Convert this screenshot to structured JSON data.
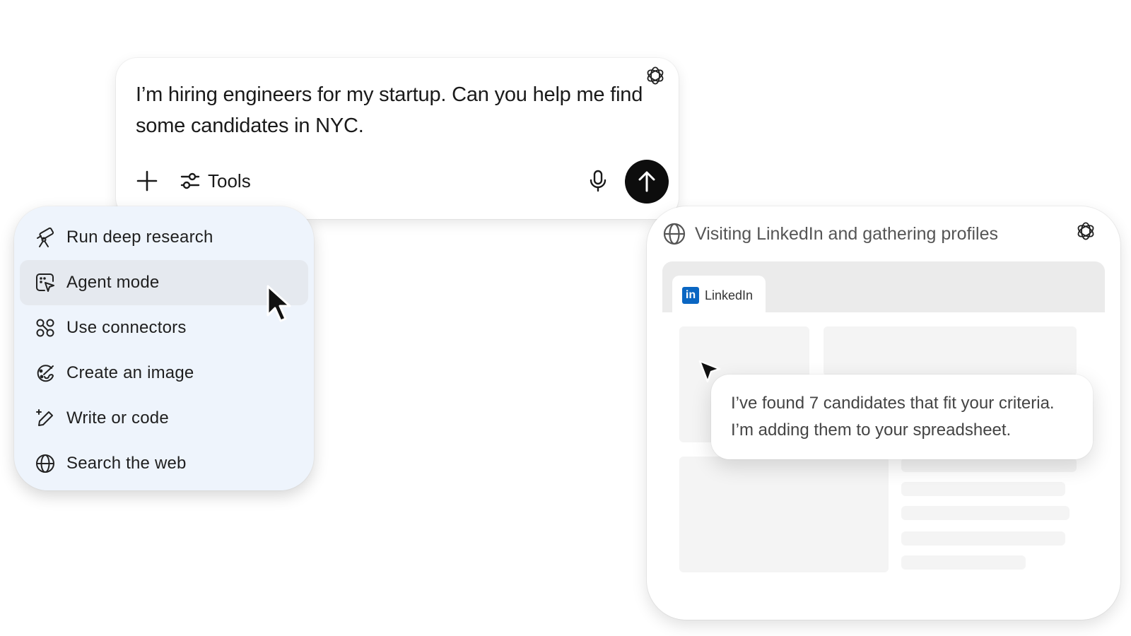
{
  "composer": {
    "prompt_text": "I’m hiring engineers for my startup. Can you help me find some candidates in NYC.",
    "plus_icon": "plus-icon",
    "tools_label": "Tools",
    "tools_icon": "sliders-icon",
    "mic_icon": "microphone-icon",
    "send_icon": "arrow-up-icon"
  },
  "tools_menu": {
    "items": [
      {
        "label": "Run deep research",
        "icon": "telescope-icon"
      },
      {
        "label": "Agent mode",
        "icon": "agent-cursor-icon",
        "active": true
      },
      {
        "label": "Use connectors",
        "icon": "connectors-icon"
      },
      {
        "label": "Create an image",
        "icon": "palette-icon"
      },
      {
        "label": "Write or code",
        "icon": "pencil-sparkle-icon"
      },
      {
        "label": "Search the web",
        "icon": "globe-icon"
      }
    ]
  },
  "agent_panel": {
    "status": "Visiting LinkedIn and gathering profiles",
    "browser_tab": {
      "label": "LinkedIn",
      "icon_text": "in"
    },
    "message_line1": "I’ve found 7 candidates that fit your criteria.",
    "message_line2": "I’m adding them to your spreadsheet."
  },
  "colors": {
    "send_button": "#0d0d0d",
    "menu_background": "#eef4fc",
    "menu_active": "#e5e9ef",
    "linkedin_blue": "#0a66c2"
  }
}
